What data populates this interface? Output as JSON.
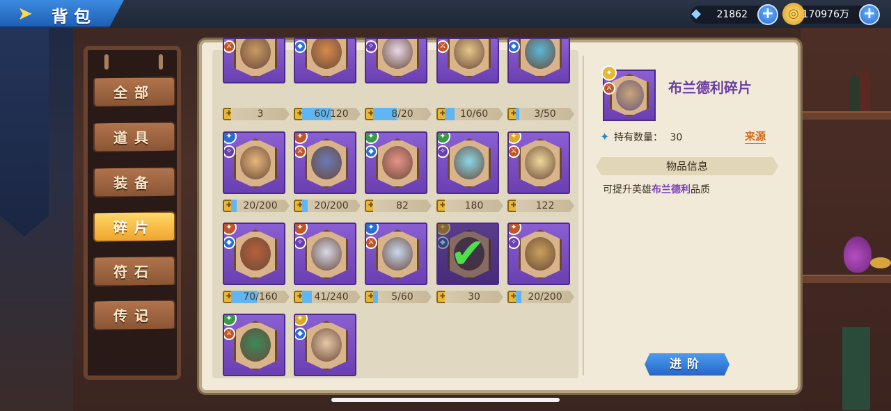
{
  "header": {
    "title": "背包",
    "diamonds": {
      "icon": "diamond-icon",
      "amount": "21862"
    },
    "gold": {
      "icon": "gold-coin-icon",
      "amount": "170976万"
    }
  },
  "nav": [
    {
      "label": "全部",
      "active": false
    },
    {
      "label": "道具",
      "active": false
    },
    {
      "label": "装备",
      "active": false
    },
    {
      "label": "碎片",
      "active": true
    },
    {
      "label": "符石",
      "active": false
    },
    {
      "label": "传记",
      "active": false
    }
  ],
  "fragments": [
    {
      "count": "3",
      "rank": "",
      "progress": 0
    },
    {
      "count": "60/120",
      "rank": "",
      "progress": 0.5
    },
    {
      "count": "8/20",
      "rank": "",
      "progress": 0.4
    },
    {
      "count": "10/60",
      "rank": "",
      "progress": 0.17
    },
    {
      "count": "3/50",
      "rank": "",
      "progress": 0.06
    },
    {
      "count": "20/200",
      "rank": "blue",
      "progress": 0.1
    },
    {
      "count": "20/200",
      "rank": "orange",
      "progress": 0.1
    },
    {
      "count": "82",
      "rank": "green",
      "progress": 0
    },
    {
      "count": "180",
      "rank": "green",
      "progress": 0
    },
    {
      "count": "122",
      "rank": "gold",
      "progress": 0
    },
    {
      "count": "70/160",
      "rank": "orange",
      "progress": 0.44
    },
    {
      "count": "41/240",
      "rank": "orange",
      "progress": 0.17
    },
    {
      "count": "5/60",
      "rank": "blue",
      "progress": 0.08
    },
    {
      "count": "30",
      "rank": "gold",
      "progress": 0,
      "selected": true
    },
    {
      "count": "20/200",
      "rank": "orange",
      "progress": 0.1
    },
    {
      "count": "",
      "rank": "green",
      "progress": 0
    },
    {
      "count": "",
      "rank": "gold",
      "progress": 0
    }
  ],
  "detail": {
    "name": "布兰德利碎片",
    "own_label": "持有数量：",
    "own_count": "30",
    "source_label": "来源",
    "info_title": "物品信息",
    "desc_prefix": "可提升英雄",
    "desc_hero": "布兰德利",
    "desc_suffix": "品质",
    "advance_label": "进阶"
  }
}
